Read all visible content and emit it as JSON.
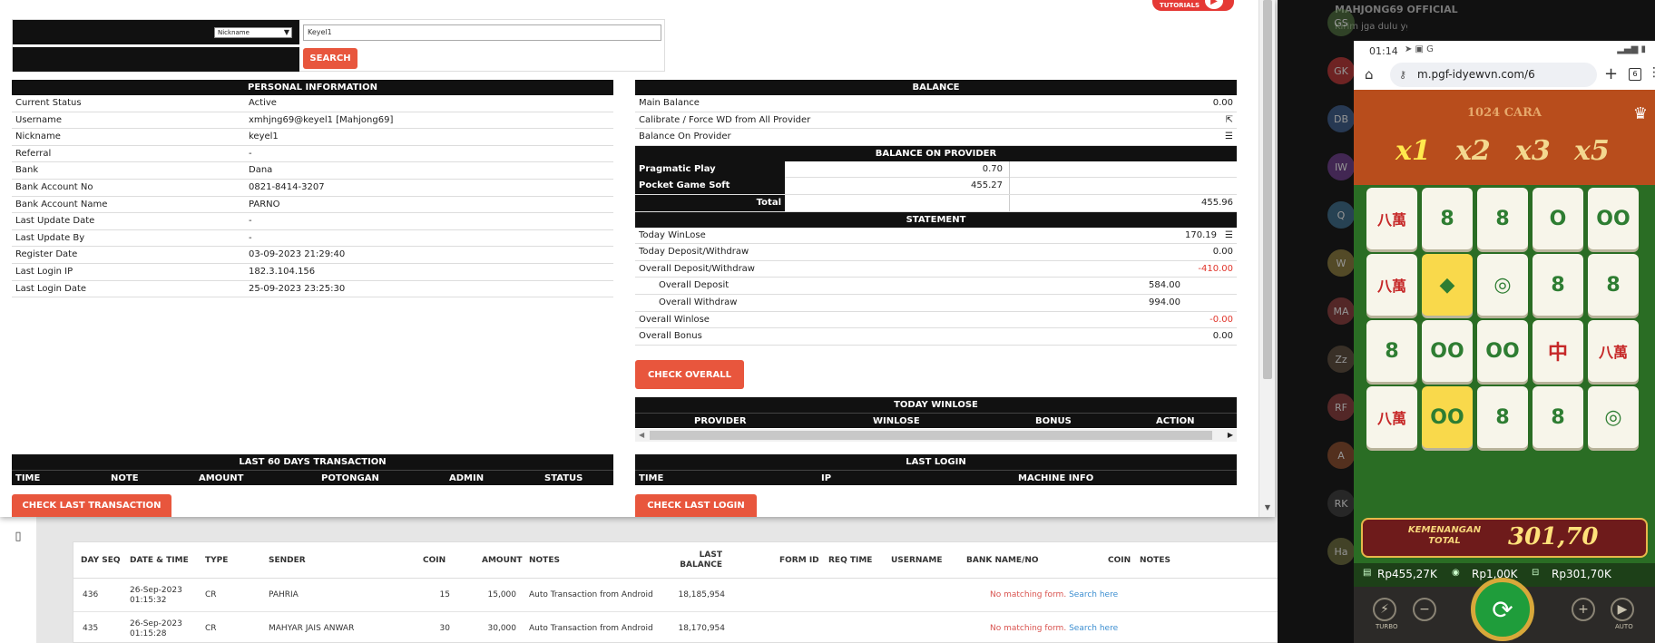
{
  "tutorials_label": "TUTORIALS",
  "search": {
    "select_value": "Nickname",
    "keyword": "Keyel1",
    "button": "SEARCH"
  },
  "personal": {
    "title": "PERSONAL INFORMATION",
    "rows": [
      {
        "k": "Current Status",
        "v": "Active"
      },
      {
        "k": "Username",
        "v": "xmhjng69@keyel1  [Mahjong69]"
      },
      {
        "k": "Nickname",
        "v": "keyel1"
      },
      {
        "k": "Referral",
        "v": "-"
      },
      {
        "k": "Bank",
        "v": "Dana"
      },
      {
        "k": "Bank Account No",
        "v": "0821-8414-3207"
      },
      {
        "k": "Bank Account Name",
        "v": "PARNO"
      },
      {
        "k": "Last Update Date",
        "v": "-"
      },
      {
        "k": "Last Update By",
        "v": "-"
      },
      {
        "k": "Register Date",
        "v": "03-09-2023 21:29:40"
      },
      {
        "k": "Last Login IP",
        "v": "182.3.104.156"
      },
      {
        "k": "Last Login Date",
        "v": "25-09-2023 23:25:30"
      }
    ]
  },
  "balance": {
    "title": "BALANCE",
    "main_balance_label": "Main Balance",
    "main_balance": "0.00",
    "calibrate_label": "Calibrate / Force WD from All Provider",
    "balance_on_provider_label": "Balance On Provider"
  },
  "provider_balance": {
    "title": "BALANCE ON PROVIDER",
    "rows": [
      {
        "name": "Pragmatic Play",
        "value": "0.70"
      },
      {
        "name": "Pocket Game Soft",
        "value": "455.27"
      }
    ],
    "total_label": "Total",
    "total": "455.96"
  },
  "statement": {
    "title": "STATEMENT",
    "today_winlose_label": "Today WinLose",
    "today_winlose": "170.19",
    "today_dw_label": "Today Deposit/Withdraw",
    "today_dw": "0.00",
    "overall_dw_label": "Overall Deposit/Withdraw",
    "overall_dw": "-410.00",
    "overall_deposit_label": "Overall Deposit",
    "overall_deposit": "584.00",
    "overall_withdraw_label": "Overall Withdraw",
    "overall_withdraw": "994.00",
    "overall_winlose_label": "Overall Winlose",
    "overall_winlose": "-0.00",
    "overall_bonus_label": "Overall Bonus",
    "overall_bonus": "0.00",
    "check_button": "CHECK OVERALL"
  },
  "today_winlose": {
    "title": "TODAY WINLOSE",
    "columns": [
      "PROVIDER",
      "WINLOSE",
      "BONUS",
      "ACTION"
    ]
  },
  "last60": {
    "title": "LAST 60 DAYS TRANSACTION",
    "columns": [
      "TIME",
      "NOTE",
      "AMOUNT",
      "POTONGAN",
      "ADMIN",
      "STATUS"
    ],
    "button": "CHECK LAST TRANSACTION"
  },
  "last_login": {
    "title": "LAST LOGIN",
    "columns": [
      "TIME",
      "IP",
      "MACHINE INFO"
    ],
    "button": "CHECK LAST LOGIN"
  },
  "bg_table": {
    "columns": [
      "DAY SEQ",
      "DATE & TIME",
      "TYPE",
      "SENDER",
      "COIN",
      "AMOUNT",
      "NOTES",
      "LAST BALANCE",
      "FORM ID",
      "REQ TIME",
      "USERNAME",
      "BANK NAME/NO",
      "COIN",
      "NOTES"
    ],
    "rows": [
      {
        "seq": "436",
        "date": "26-Sep-2023",
        "time": "01:15:32",
        "type": "CR",
        "sender": "PAHRIA",
        "coin": "15",
        "amount": "15,000",
        "notes": "Auto Transaction from Android",
        "last_balance": "18,185,954"
      },
      {
        "seq": "435",
        "date": "26-Sep-2023",
        "time": "01:15:28",
        "type": "CR",
        "sender": "MAHYAR JAIS ANWAR",
        "coin": "30",
        "amount": "30,000",
        "notes": "Auto Transaction from Android",
        "last_balance": "18,170,954"
      }
    ],
    "no_match": "No matching form.",
    "search_here": "Search here"
  },
  "chat": {
    "header_name": "MAHJONG69 OFFICIAL",
    "header_msg": "Kirim jga dulu yg tengging bar di",
    "avatars": [
      "GS",
      "GK",
      "DB",
      "IW",
      "Q",
      "W",
      "MA",
      "Zz",
      "RF",
      "A",
      "RK",
      "Ha"
    ]
  },
  "phone": {
    "clock": "01:14",
    "url": "m.pgf-idyewvn.com/6",
    "tabs": "6",
    "game_caption": "1024 CARA",
    "multipliers": [
      "x1",
      "x2",
      "x3",
      "x5"
    ],
    "win_label": "KEMENANGAN TOTAL",
    "win_value": "301,70",
    "balance": "Rp455,27K",
    "bet": "Rp1,00K",
    "win": "Rp301,70K",
    "turbo_label": "TURBO",
    "auto_label": "AUTO",
    "tiles": [
      "八萬",
      "8",
      "8",
      "O",
      "OO",
      "八萬",
      "◆",
      "◎",
      "8",
      "8",
      "8",
      "OO",
      "OO",
      "中",
      "八萬",
      "八萬",
      "OO",
      "8",
      "8",
      "◎"
    ]
  }
}
